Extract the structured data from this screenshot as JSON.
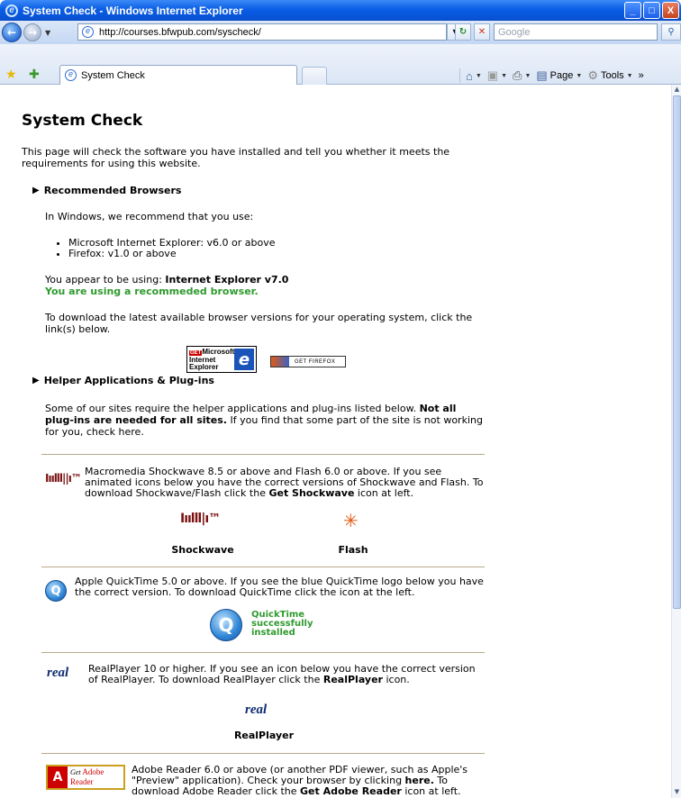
{
  "window": {
    "title": "System Check - Windows Internet Explorer",
    "minimize": "_",
    "maximize": "□",
    "close": "X"
  },
  "toolbar": {
    "url": "http://courses.bfwpub.com/syscheck/",
    "search_placeholder": "Google",
    "tab_title": "System Check",
    "page_label": "Page",
    "tools_label": "Tools",
    "overflow": "»"
  },
  "page": {
    "title": "System Check",
    "intro": "This page will check the software you have installed and tell you whether it meets the requirements for using this website.",
    "browsers_heading": "Recommended Browsers",
    "windows_recommend": "In Windows, we recommend that you use:",
    "browser_list": [
      "Microsoft Internet Explorer: v6.0 or above",
      "Firefox: v1.0 or above"
    ],
    "using_prefix": "You appear to be using: ",
    "using_browser": "Internet Explorer v7.0",
    "using_status": "You are using a recommeded browser.",
    "download_text": "To download the latest available browser versions for your operating system, click the link(s) below.",
    "ie_badge": {
      "get": "GET",
      "line1": "Microsoft",
      "line2": "Internet",
      "line3": "Explorer"
    },
    "firefox_badge": "GET FIREFOX",
    "helper_heading": "Helper Applications & Plug-ins",
    "helper_text_1": "Some of our sites require the helper applications and plug-ins listed below.",
    "helper_text_bold": "Not all plug-ins are needed for all sites.",
    "helper_text_2": "If you find that some part of the site is not working for you, check here.",
    "shockwave_text_1": "Macromedia Shockwave 8.5 or above and Flash 6.0 or above. If you see animated icons below you have the correct versions of Shockwave and Flash. To download Shockwave/Flash click the ",
    "shockwave_link": "Get Shockwave",
    "shockwave_text_2": " icon at left.",
    "shockwave_label": "Shockwave",
    "flash_label": "Flash",
    "quicktime_text": "Apple QuickTime 5.0 or above. If you see the blue QuickTime logo below you have the correct version. To download QuickTime click the icon at the left.",
    "quicktime_status": [
      "QuickTime",
      "successfully",
      "installed"
    ],
    "real_text_1": "RealPlayer 10 or higher. If you see an icon below you have the correct version of RealPlayer. To download RealPlayer click the ",
    "real_link": "RealPlayer",
    "real_text_2": " icon.",
    "real_label": "RealPlayer",
    "real_logo": "real",
    "adobe_text_1": "Adobe Reader 6.0 or above (or another PDF viewer, such as Apple's \"Preview\" application). Check your browser by clicking ",
    "adobe_here": "here.",
    "adobe_text_2": " To download Adobe Reader click the ",
    "adobe_link": "Get Adobe Reader",
    "adobe_text_3": " icon at left.",
    "adobe_badge": {
      "get": "Get",
      "line1": "Adobe",
      "line2": "Reader"
    }
  },
  "icons": {
    "back": "back-arrow-icon",
    "forward": "forward-arrow-icon",
    "refresh": "refresh-icon",
    "stop": "stop-icon",
    "search": "search-icon",
    "favorites": "favorites-star-icon",
    "add_favorites": "add-favorites-icon",
    "home": "home-icon",
    "feeds": "feeds-icon",
    "print": "print-icon"
  },
  "colors": {
    "title_bar": "#0a5ee6",
    "success_green": "#2e9a2e"
  }
}
